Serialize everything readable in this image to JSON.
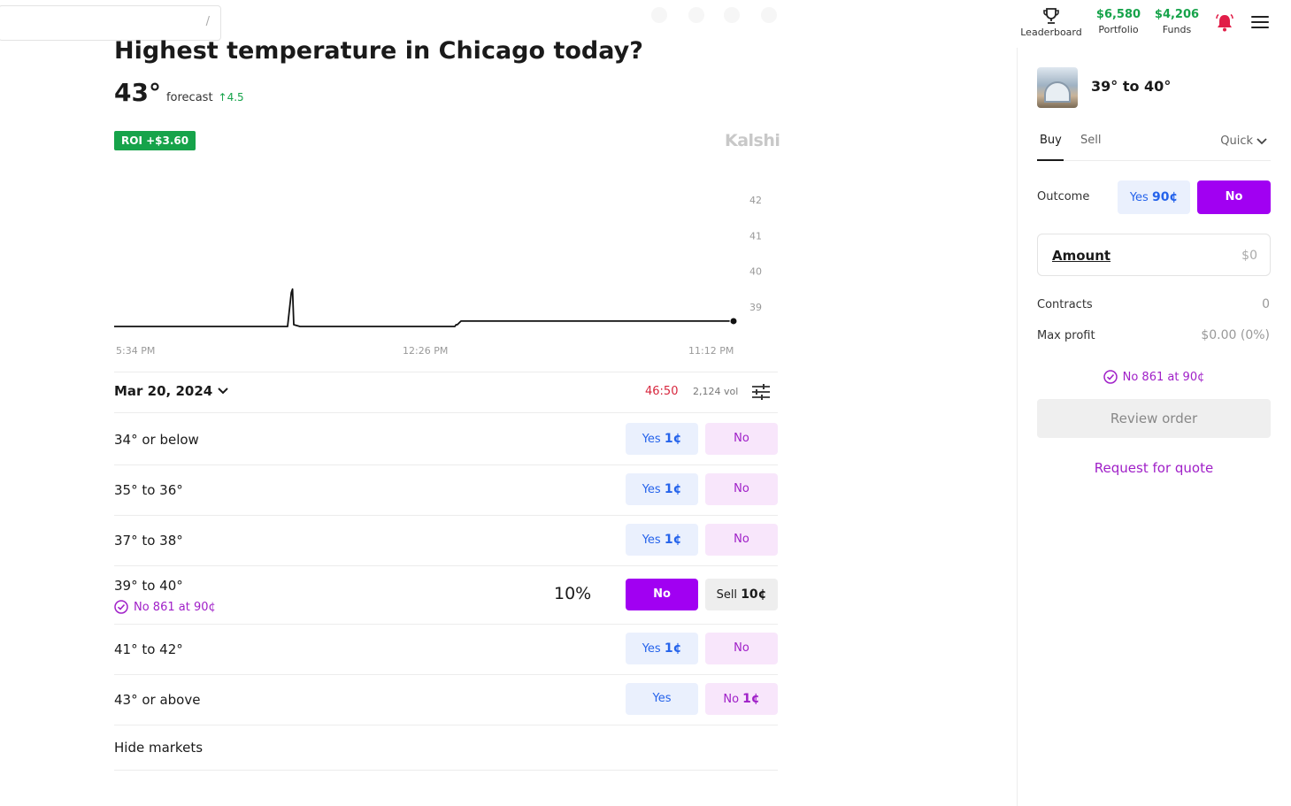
{
  "header": {
    "search_hint": "/",
    "leaderboard_label": "Leaderboard",
    "portfolio_value": "$6,580",
    "portfolio_label": "Portfolio",
    "funds_value": "$4,206",
    "funds_label": "Funds",
    "accent_green": "#16a34a",
    "bell_color": "#e11d48"
  },
  "market": {
    "title": "Highest temperature in Chicago today?",
    "forecast_temp": "43°",
    "forecast_label": "forecast",
    "forecast_change": "↑4.5",
    "roi_badge": "ROI +$3.60",
    "brand": "Kalshi"
  },
  "chart_data": {
    "type": "line",
    "title": "",
    "x_tick_labels": [
      "5:34 PM",
      "12:26 PM",
      "11:12 PM"
    ],
    "y_tick_labels": [
      "42",
      "41",
      "40",
      "39"
    ],
    "ylim": [
      38.35,
      43.05
    ],
    "x": [
      0.0,
      0.28,
      0.286,
      0.288,
      0.29,
      0.3,
      0.3,
      0.31,
      0.335,
      0.35,
      0.356,
      0.36,
      0.364,
      0.378,
      0.382,
      0.385,
      0.39,
      0.4,
      0.41,
      0.42,
      0.55,
      0.552,
      0.554,
      0.56,
      0.59,
      0.592,
      0.6,
      0.62,
      0.64,
      0.665,
      0.666,
      0.668,
      0.67,
      0.73,
      0.77,
      0.774,
      0.775,
      0.778,
      0.784,
      0.786,
      0.787,
      0.788,
      0.789,
      0.79,
      0.8,
      0.84,
      0.87,
      0.88,
      0.9,
      0.93,
      0.95,
      0.958,
      0.96,
      0.963,
      0.968,
      0.97,
      0.975,
      1.0
    ],
    "values": [
      38.45,
      38.45,
      39.4,
      39.5,
      38.5,
      38.45,
      38.45,
      38.45,
      38.45,
      38.45,
      38.45,
      38.45,
      38.45,
      38.45,
      38.45,
      38.45,
      38.45,
      38.45,
      38.45,
      38.45,
      38.45,
      38.5,
      38.5,
      38.6,
      38.6,
      38.6,
      38.6,
      38.6,
      38.6,
      38.6,
      38.6,
      38.6,
      38.6,
      38.6,
      38.6,
      38.6,
      38.6,
      38.6,
      38.6,
      38.6,
      38.6,
      38.6,
      38.6,
      38.6,
      38.6,
      38.6,
      38.6,
      38.6,
      38.6,
      38.6,
      38.6,
      38.6,
      38.6,
      38.6,
      38.6,
      38.6,
      38.6,
      38.6
    ],
    "line_color": "#111111"
  },
  "date_row": {
    "date": "Mar 20, 2024",
    "timer": "46:50",
    "volume": "2,124 vol"
  },
  "markets": [
    {
      "label": "34° or below",
      "yes": "Yes",
      "yes_price": "1¢",
      "no": "No",
      "no_price": ""
    },
    {
      "label": "35° to 36°",
      "yes": "Yes",
      "yes_price": "1¢",
      "no": "No",
      "no_price": ""
    },
    {
      "label": "37° to 38°",
      "yes": "Yes",
      "yes_price": "1¢",
      "no": "No",
      "no_price": ""
    },
    {
      "label": "39° to 40°",
      "chance": "10%",
      "no": "No",
      "sell": "Sell",
      "sell_price": "10¢",
      "position": "No 861 at 90¢"
    },
    {
      "label": "41° to 42°",
      "yes": "Yes",
      "yes_price": "1¢",
      "no": "No",
      "no_price": ""
    },
    {
      "label": "43° or above",
      "yes": "Yes",
      "yes_price": "",
      "no": "No",
      "no_price": "1¢"
    }
  ],
  "hide_markets": "Hide markets",
  "side_panel": {
    "title": "39° to 40°",
    "tab_buy": "Buy",
    "tab_sell": "Sell",
    "mode": "Quick",
    "outcome_label": "Outcome",
    "outcome_yes": "Yes",
    "outcome_yes_price": "90¢",
    "outcome_no": "No",
    "amount_label": "Amount",
    "amount_value": "$0",
    "contracts_label": "Contracts",
    "contracts_value": "0",
    "max_profit_label": "Max profit",
    "max_profit_value": "$0.00 (0%)",
    "position": "No 861 at 90¢",
    "review_button": "Review order",
    "rfq_link": "Request for quote",
    "accent_purple": "#a100f2"
  }
}
